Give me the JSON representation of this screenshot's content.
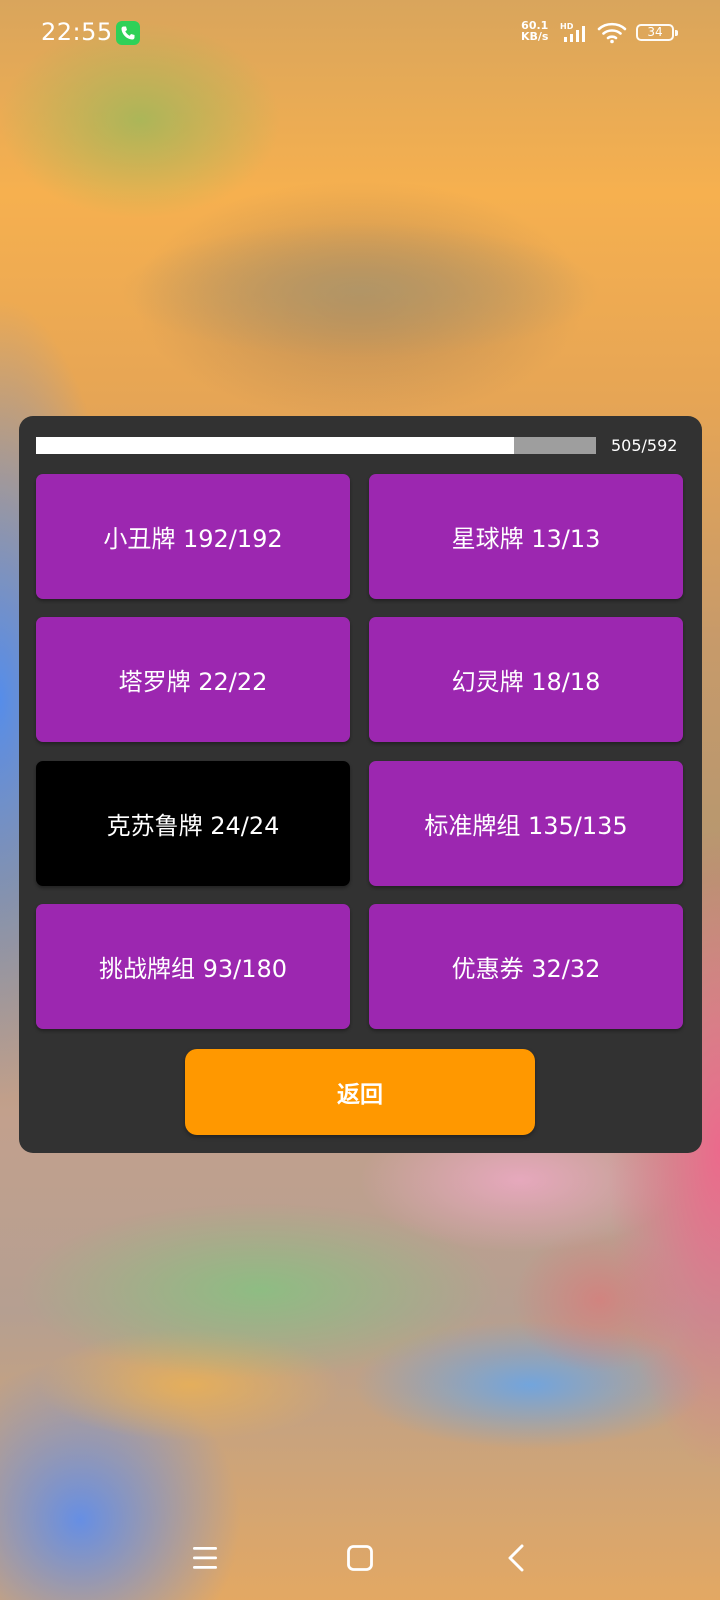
{
  "status_bar": {
    "time": "22:55",
    "net_speed_value": "60.1",
    "net_speed_unit": "KB/s",
    "network_label": "HD",
    "battery_level": "34"
  },
  "dialog": {
    "progress": {
      "text": "505/592",
      "completed": 505,
      "total": 592
    },
    "cards": [
      {
        "label": "小丑牌 192/192",
        "active": false
      },
      {
        "label": "星球牌 13/13",
        "active": false
      },
      {
        "label": "塔罗牌 22/22",
        "active": false
      },
      {
        "label": "幻灵牌 18/18",
        "active": false
      },
      {
        "label": "克苏鲁牌 24/24",
        "active": true
      },
      {
        "label": "标准牌组 135/135",
        "active": false
      },
      {
        "label": "挑战牌组 93/180",
        "active": false
      },
      {
        "label": "优惠券 32/32",
        "active": false
      }
    ],
    "back_label": "返回"
  },
  "colors": {
    "card": "#9c27b0",
    "card_active": "#000000",
    "back_button": "#ff9800",
    "dialog": "#323232",
    "progress_fill": "#ffffff",
    "progress_track": "#9e9e9e"
  },
  "nav_bar": {
    "icons": [
      "menu-icon",
      "home-icon",
      "back-icon"
    ]
  }
}
